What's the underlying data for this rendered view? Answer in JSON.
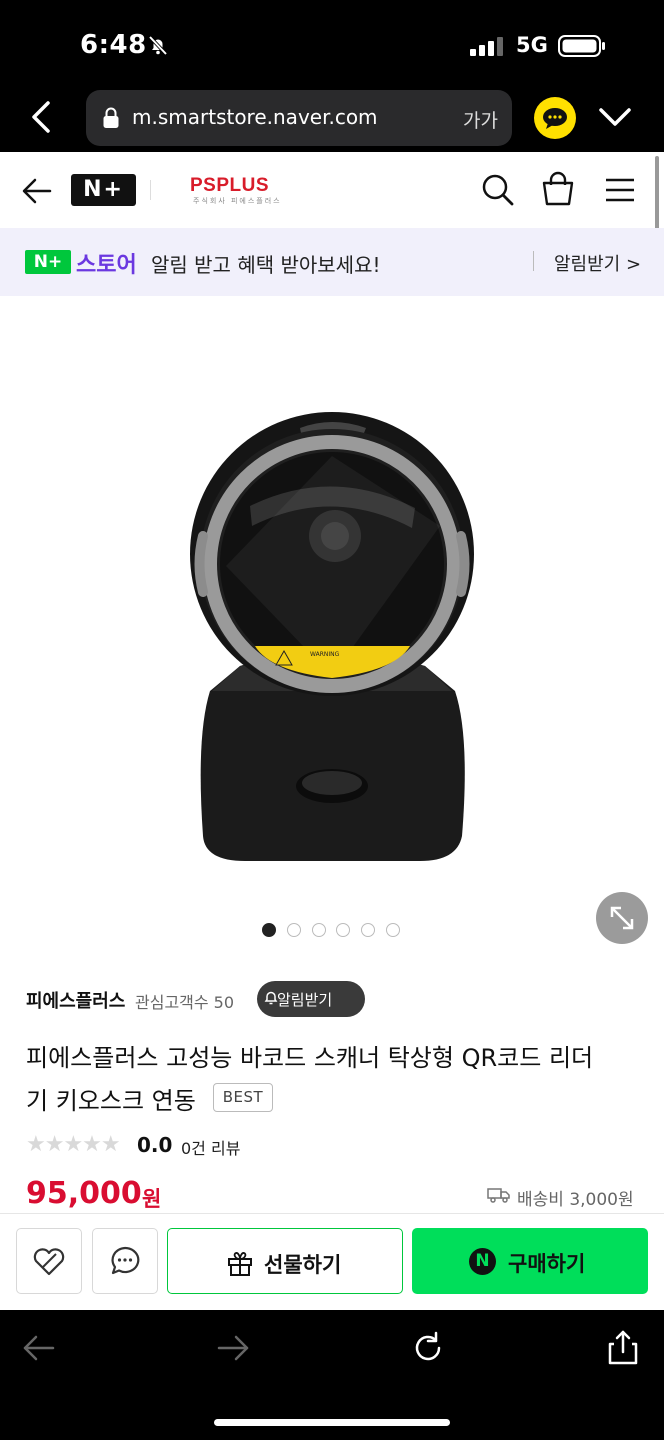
{
  "status_bar": {
    "time": "6:48",
    "network": "5G"
  },
  "browser": {
    "url": "m.smartstore.naver.com",
    "text_size_label": "가가"
  },
  "header": {
    "logo": "N+",
    "brand": "PSPLUS",
    "brand_sub": "주식회사 피에스플러스"
  },
  "notice": {
    "badge": "N+",
    "store_label": "스토어",
    "message": "알림 받고 혜택 받아보세요!",
    "action": "알림받기 >"
  },
  "carousel": {
    "total": 6,
    "active_index": 0
  },
  "product": {
    "store_name": "피에스플러스",
    "fans_label": "관심고객수 50",
    "alert_button": "알림받기",
    "title_line1": "피에스플러스 고성능 바코드 스캐너 탁상형 QR코드 리더",
    "title_line2": "기 키오스크 연동",
    "badge": "BEST",
    "stars": "★★★★★",
    "rating": "0.0",
    "reviews": "0건 리뷰",
    "price": "95,000",
    "currency": "원",
    "shipping": "배송비 3,000원",
    "label_text": "WARNING"
  },
  "actions": {
    "gift": "선물하기",
    "buy": "구매하기",
    "npay_letter": "N"
  },
  "colors": {
    "accent_green": "#00de5a",
    "price_red": "#d90d31",
    "store_purple": "#6b38e0",
    "brand_red": "#d81c2a"
  }
}
